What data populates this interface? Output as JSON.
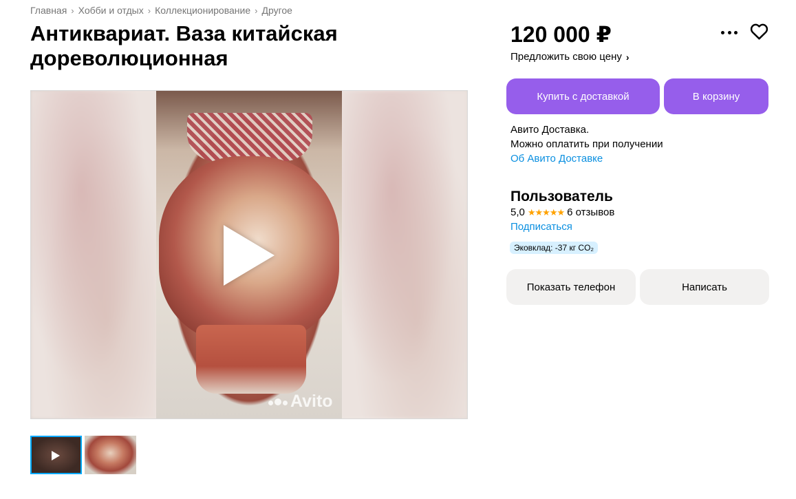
{
  "breadcrumbs": [
    "Главная",
    "Хобби и отдых",
    "Коллекционирование",
    "Другое"
  ],
  "title": "Антиквариат. Ваза китайская дореволюционная",
  "media": {
    "watermark": "Avito"
  },
  "price": "120 000 ₽",
  "offer_price": "Предложить свою цену",
  "buttons": {
    "buy_delivery": "Купить с доставкой",
    "cart": "В корзину",
    "show_phone": "Показать телефон",
    "write": "Написать"
  },
  "delivery": {
    "line1": "Авито Доставка.",
    "line2": "Можно оплатить при получении",
    "link": "Об Авито Доставке"
  },
  "seller": {
    "name": "Пользователь",
    "rating": "5,0",
    "stars": "★★★★★",
    "reviews": "6 отзывов",
    "subscribe": "Подписаться",
    "eco_badge": "Эковклад: -37 кг CO₂"
  },
  "colors": {
    "accent": "#965eeb",
    "link": "#0a8fe0",
    "star": "#ffa200",
    "thumb_selected": "#00aaff"
  }
}
